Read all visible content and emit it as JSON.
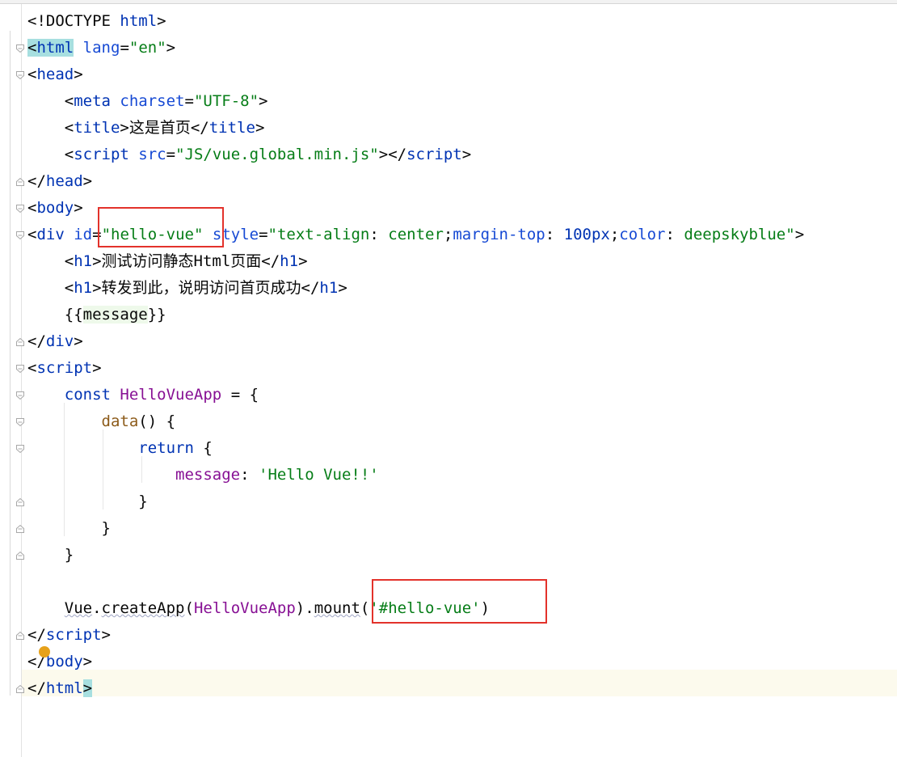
{
  "editor": {
    "lines": [
      {
        "n": 1,
        "tokens": [
          [
            "plain",
            "<!DOCTYPE "
          ],
          [
            "tag",
            "html"
          ],
          [
            "plain",
            ">"
          ]
        ]
      },
      {
        "n": 2,
        "tokens": [
          [
            "plain",
            ""
          ],
          [
            "tag-hl-open",
            "<html"
          ],
          [
            "plain",
            " "
          ],
          [
            "attr",
            "lang"
          ],
          [
            "plain",
            "="
          ],
          [
            "str",
            "\"en\""
          ],
          [
            "plain",
            ">"
          ]
        ]
      },
      {
        "n": 3,
        "tokens": [
          [
            "plain",
            "<"
          ],
          [
            "tag",
            "head"
          ],
          [
            "plain",
            ">"
          ]
        ]
      },
      {
        "n": 4,
        "tokens": [
          [
            "plain",
            "    <"
          ],
          [
            "tag",
            "meta"
          ],
          [
            "plain",
            " "
          ],
          [
            "attr",
            "charset"
          ],
          [
            "plain",
            "="
          ],
          [
            "str",
            "\"UTF-8\""
          ],
          [
            "plain",
            ">"
          ]
        ]
      },
      {
        "n": 5,
        "tokens": [
          [
            "plain",
            "    <"
          ],
          [
            "tag",
            "title"
          ],
          [
            "plain",
            ">这是首页</"
          ],
          [
            "tag",
            "title"
          ],
          [
            "plain",
            ">"
          ]
        ]
      },
      {
        "n": 6,
        "tokens": [
          [
            "plain",
            "    <"
          ],
          [
            "tag",
            "script"
          ],
          [
            "plain",
            " "
          ],
          [
            "attr",
            "src"
          ],
          [
            "plain",
            "="
          ],
          [
            "str",
            "\"JS/vue.global.min.js\""
          ],
          [
            "plain",
            "></"
          ],
          [
            "tag",
            "script"
          ],
          [
            "plain",
            ">"
          ]
        ]
      },
      {
        "n": 7,
        "tokens": [
          [
            "plain",
            "</"
          ],
          [
            "tag",
            "head"
          ],
          [
            "plain",
            ">"
          ]
        ]
      },
      {
        "n": 8,
        "tokens": [
          [
            "plain",
            "<"
          ],
          [
            "tag",
            "body"
          ],
          [
            "plain",
            ">"
          ]
        ]
      },
      {
        "n": 9,
        "tokens": [
          [
            "plain",
            "<"
          ],
          [
            "tag",
            "div"
          ],
          [
            "plain",
            " "
          ],
          [
            "attr",
            "id"
          ],
          [
            "plain",
            "="
          ],
          [
            "str",
            "\"hello-vue\""
          ],
          [
            "plain",
            " "
          ],
          [
            "attr",
            "style"
          ],
          [
            "plain",
            "="
          ],
          [
            "str",
            "\"text-align"
          ],
          [
            "plain",
            ": "
          ],
          [
            "str",
            "center"
          ],
          [
            "plain",
            ";"
          ],
          [
            "attr",
            "margin-top"
          ],
          [
            "plain",
            ": "
          ],
          [
            "kw",
            "100px"
          ],
          [
            "plain",
            ";"
          ],
          [
            "attr",
            "color"
          ],
          [
            "plain",
            ": "
          ],
          [
            "str",
            "deepskyblue"
          ],
          [
            "str",
            "\""
          ],
          [
            "plain",
            ">"
          ]
        ]
      },
      {
        "n": 10,
        "tokens": [
          [
            "plain",
            "    <"
          ],
          [
            "tag",
            "h1"
          ],
          [
            "plain",
            ">测试访问静态Html页面</"
          ],
          [
            "tag",
            "h1"
          ],
          [
            "plain",
            ">"
          ]
        ]
      },
      {
        "n": 11,
        "tokens": [
          [
            "plain",
            "    <"
          ],
          [
            "tag",
            "h1"
          ],
          [
            "plain",
            ">转发到此，说明访问首页成功</"
          ],
          [
            "tag",
            "h1"
          ],
          [
            "plain",
            ">"
          ]
        ]
      },
      {
        "n": 12,
        "tokens": [
          [
            "plain",
            "    {{"
          ],
          [
            "msg",
            "message"
          ],
          [
            "plain",
            "}}"
          ]
        ]
      },
      {
        "n": 13,
        "tokens": [
          [
            "plain",
            "</"
          ],
          [
            "tag",
            "div"
          ],
          [
            "plain",
            ">"
          ]
        ]
      },
      {
        "n": 14,
        "tokens": [
          [
            "plain",
            "<"
          ],
          [
            "tag",
            "script"
          ],
          [
            "plain",
            ">"
          ]
        ]
      },
      {
        "n": 15,
        "tokens": [
          [
            "plain",
            "    "
          ],
          [
            "kw",
            "const"
          ],
          [
            "plain",
            " "
          ],
          [
            "method-purple",
            "HelloVueApp"
          ],
          [
            "plain",
            " = {"
          ]
        ]
      },
      {
        "n": 16,
        "tokens": [
          [
            "plain",
            "        "
          ],
          [
            "dt",
            "data"
          ],
          [
            "plain",
            "() {"
          ]
        ]
      },
      {
        "n": 17,
        "tokens": [
          [
            "plain",
            "            "
          ],
          [
            "kw",
            "return"
          ],
          [
            "plain",
            " {"
          ]
        ]
      },
      {
        "n": 18,
        "tokens": [
          [
            "plain",
            "                "
          ],
          [
            "prop",
            "message"
          ],
          [
            "plain",
            ": "
          ],
          [
            "str",
            "'Hello Vue!!'"
          ]
        ]
      },
      {
        "n": 19,
        "tokens": [
          [
            "plain",
            "            }"
          ]
        ]
      },
      {
        "n": 20,
        "tokens": [
          [
            "plain",
            "        }"
          ]
        ]
      },
      {
        "n": 21,
        "tokens": [
          [
            "plain",
            "    }"
          ]
        ]
      },
      {
        "n": 22,
        "tokens": [
          [
            "plain",
            ""
          ]
        ]
      },
      {
        "n": 23,
        "tokens": [
          [
            "plain",
            "    "
          ],
          [
            "squig",
            "Vue"
          ],
          [
            "plain",
            "."
          ],
          [
            "squig",
            "createApp"
          ],
          [
            "plain",
            "("
          ],
          [
            "method-purple",
            "HelloVueApp"
          ],
          [
            "plain",
            ")."
          ],
          [
            "squig",
            "mount"
          ],
          [
            "plain",
            "("
          ],
          [
            "str",
            "'#hello-vue'"
          ],
          [
            "plain",
            ")"
          ]
        ]
      },
      {
        "n": 24,
        "tokens": [
          [
            "plain",
            "</"
          ],
          [
            "tag",
            "script"
          ],
          [
            "plain",
            ">"
          ]
        ]
      },
      {
        "n": 25,
        "tokens": [
          [
            "plain",
            "</"
          ],
          [
            "tag",
            "body"
          ],
          [
            "plain",
            ">"
          ]
        ]
      },
      {
        "n": 26,
        "tokens": [
          [
            "tag-hl-close",
            "</html>"
          ]
        ]
      }
    ],
    "folds": [
      {
        "line": 2,
        "dir": "down"
      },
      {
        "line": 3,
        "dir": "down"
      },
      {
        "line": 7,
        "dir": "up"
      },
      {
        "line": 8,
        "dir": "down"
      },
      {
        "line": 9,
        "dir": "down"
      },
      {
        "line": 13,
        "dir": "up"
      },
      {
        "line": 14,
        "dir": "down"
      },
      {
        "line": 15,
        "dir": "down"
      },
      {
        "line": 16,
        "dir": "down"
      },
      {
        "line": 17,
        "dir": "down"
      },
      {
        "line": 19,
        "dir": "up"
      },
      {
        "line": 20,
        "dir": "up"
      },
      {
        "line": 21,
        "dir": "up"
      },
      {
        "line": 24,
        "dir": "up"
      },
      {
        "line": 26,
        "dir": "up"
      }
    ]
  },
  "colors": {
    "tag": "#0033b3",
    "string": "#067d17",
    "annotation_box": "#e3322b",
    "breakpoint": "#e6a11a"
  }
}
